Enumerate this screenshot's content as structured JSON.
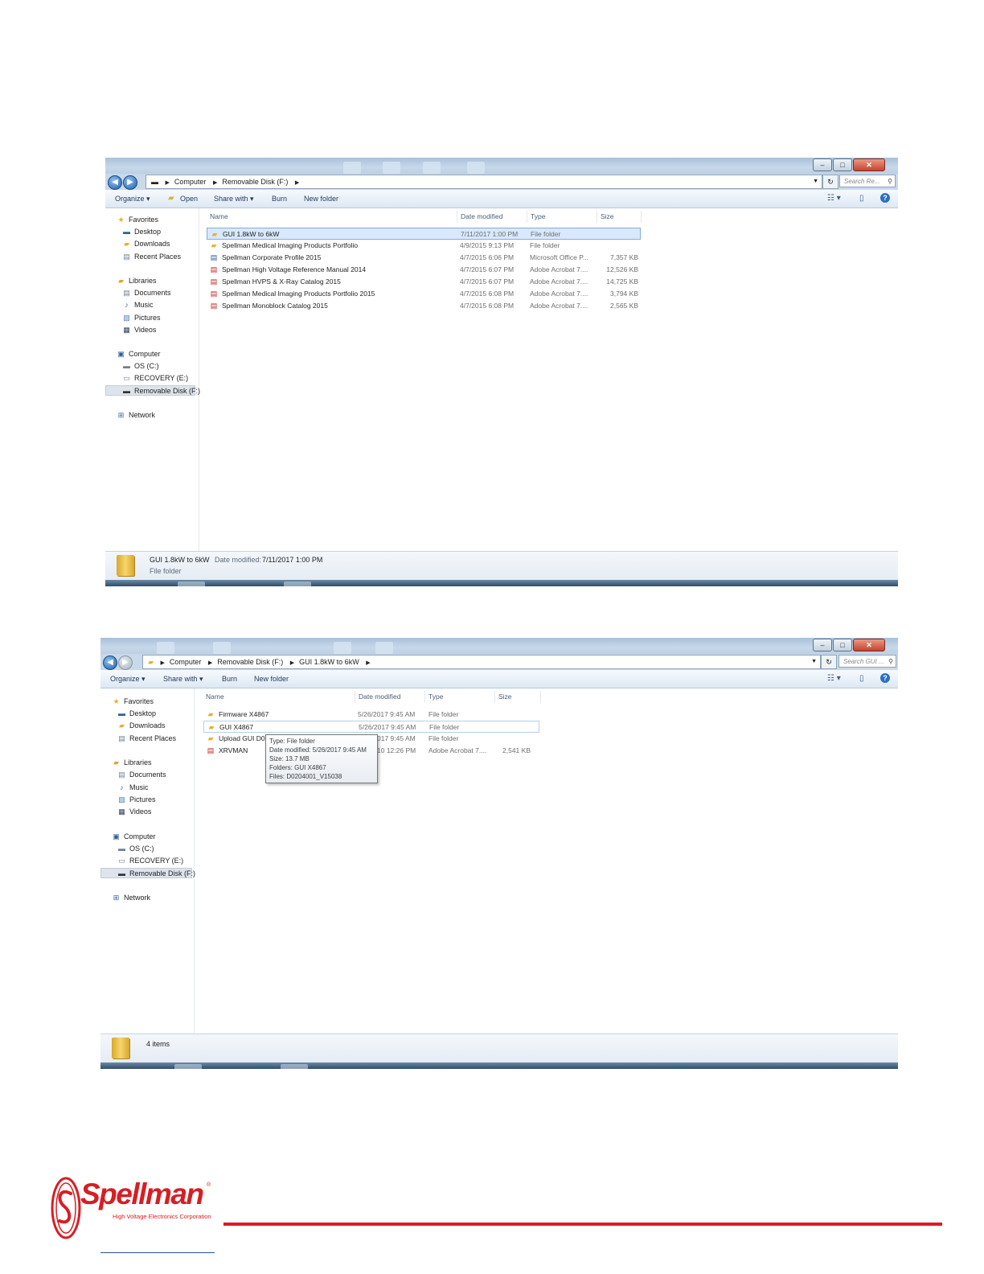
{
  "window1": {
    "address": [
      "Computer",
      "Removable Disk (F:)"
    ],
    "search_placeholder": "Search Re...",
    "toolbar": {
      "organize": "Organize ▾",
      "open": "Open",
      "share_with": "Share with ▾",
      "burn": "Burn",
      "new_folder": "New folder"
    },
    "nav": {
      "favorites": "Favorites",
      "desktop": "Desktop",
      "downloads": "Downloads",
      "recent_places": "Recent Places",
      "libraries": "Libraries",
      "documents": "Documents",
      "music": "Music",
      "pictures": "Pictures",
      "videos": "Videos",
      "computer": "Computer",
      "os_c": "OS (C:)",
      "recovery_e": "RECOVERY (E:)",
      "removable_f": "Removable Disk (F:)",
      "network": "Network"
    },
    "columns": {
      "name": "Name",
      "date_modified": "Date modified",
      "type": "Type",
      "size": "Size"
    },
    "files": [
      {
        "name": "GUI 1.8kW to 6kW",
        "date": "7/11/2017 1:00 PM",
        "type": "File folder",
        "size": "",
        "icon": "folder-icon"
      },
      {
        "name": "Spellman Medical Imaging Products Portfolio",
        "date": "4/9/2015 9:13 PM",
        "type": "File folder",
        "size": "",
        "icon": "folder-icon"
      },
      {
        "name": "Spellman Corporate Profile 2015",
        "date": "4/7/2015 6:06 PM",
        "type": "Microsoft Office P...",
        "size": "7,357 KB",
        "icon": "powerpoint-icon"
      },
      {
        "name": "Spellman High Voltage Reference Manual 2014",
        "date": "4/7/2015 6:07 PM",
        "type": "Adobe Acrobat 7....",
        "size": "12,526 KB",
        "icon": "pdf-icon"
      },
      {
        "name": "Spellman HVPS & X-Ray Catalog 2015",
        "date": "4/7/2015 6:07 PM",
        "type": "Adobe Acrobat 7....",
        "size": "14,725 KB",
        "icon": "pdf-icon"
      },
      {
        "name": "Spellman Medical Imaging Products Portfolio 2015",
        "date": "4/7/2015 6:08 PM",
        "type": "Adobe Acrobat 7....",
        "size": "3,794 KB",
        "icon": "pdf-icon"
      },
      {
        "name": "Spellman Monoblock Catalog 2015",
        "date": "4/7/2015 6:08 PM",
        "type": "Adobe Acrobat 7....",
        "size": "2,565 KB",
        "icon": "pdf-icon"
      }
    ],
    "details": {
      "name": "GUI 1.8kW to 6kW",
      "date_label": "Date modified:",
      "date_value": "7/11/2017 1:00 PM",
      "type": "File folder"
    }
  },
  "window2": {
    "address": [
      "Computer",
      "Removable Disk (F:)",
      "GUI 1.8kW to 6kW"
    ],
    "search_placeholder": "Search GUI ...",
    "toolbar": {
      "organize": "Organize ▾",
      "share_with": "Share with ▾",
      "burn": "Burn",
      "new_folder": "New folder"
    },
    "nav": {
      "favorites": "Favorites",
      "desktop": "Desktop",
      "downloads": "Downloads",
      "recent_places": "Recent Places",
      "libraries": "Libraries",
      "documents": "Documents",
      "music": "Music",
      "pictures": "Pictures",
      "videos": "Videos",
      "computer": "Computer",
      "os_c": "OS (C:)",
      "recovery_e": "RECOVERY (E:)",
      "removable_f": "Removable Disk (F:)",
      "network": "Network"
    },
    "columns": {
      "name": "Name",
      "date_modified": "Date modified",
      "type": "Type",
      "size": "Size"
    },
    "files": [
      {
        "name": "Firmware X4867",
        "date": "5/26/2017 9:45 AM",
        "type": "File folder",
        "size": "",
        "icon": "folder-icon"
      },
      {
        "name": "GUI X4867",
        "date": "5/26/2017 9:45 AM",
        "type": "File folder",
        "size": "",
        "icon": "folder-icon"
      },
      {
        "name": "Upload GUI D01",
        "date": "017 9:45 AM",
        "type": "File folder",
        "size": "",
        "icon": "folder-icon"
      },
      {
        "name": "XRVMAN",
        "date": "10 12:26 PM",
        "type": "Adobe Acrobat 7....",
        "size": "2,541 KB",
        "icon": "pdf-icon"
      }
    ],
    "tooltip": {
      "type": "Type: File folder",
      "date": "Date modified: 5/26/2017 9:45 AM",
      "size": "Size: 13.7 MB",
      "folders": "Folders: GUI X4867",
      "files": "Files: D0204001_V15038"
    },
    "details": {
      "count": "4 items"
    }
  },
  "logo": {
    "name": "Spellman",
    "tagline": "High Voltage Electronics Corporation",
    "reg": "®"
  },
  "colors": {
    "brand_red": "#d61e24",
    "selection": "#d9e8fb",
    "link_blue": "#2b4ea0"
  }
}
